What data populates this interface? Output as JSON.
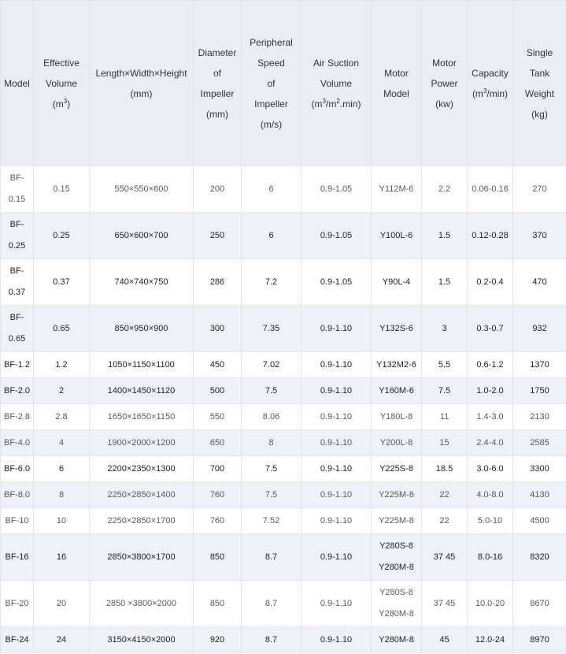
{
  "headers": [
    {
      "key": "model",
      "lines": [
        "Model"
      ]
    },
    {
      "key": "effective_volume",
      "lines": [
        "Effective",
        "Volume",
        "(m³)"
      ]
    },
    {
      "key": "dimensions",
      "lines": [
        "Length×Width×Height",
        "(mm)"
      ]
    },
    {
      "key": "impeller_diameter",
      "lines": [
        "Diameter",
        "of",
        "Impeller",
        "(mm)"
      ]
    },
    {
      "key": "peripheral_speed",
      "lines": [
        "Peripheral",
        "Speed",
        "of",
        "Impeller",
        "(m/s)"
      ]
    },
    {
      "key": "air_suction_volume",
      "lines": [
        "Air Suction",
        "Volume",
        "(m³/m².min)"
      ]
    },
    {
      "key": "motor_model",
      "lines": [
        "Motor",
        "Model"
      ]
    },
    {
      "key": "motor_power",
      "lines": [
        "Motor",
        "Power",
        "(kw)"
      ]
    },
    {
      "key": "capacity",
      "lines": [
        "Capacity",
        "(m³/min)"
      ]
    },
    {
      "key": "tank_weight",
      "lines": [
        "Single",
        "Tank",
        "Weight",
        "(kg)"
      ]
    }
  ],
  "rows": [
    {
      "model": "BF-0.15",
      "effective_volume": "0.15",
      "dimensions": "550×550×600",
      "impeller_diameter": "200",
      "peripheral_speed": "6",
      "air_suction_volume": "0.9-1.05",
      "motor_model": [
        "Y112M-6"
      ],
      "motor_power": "2.2",
      "capacity": "0.06-0.16",
      "tank_weight": "270"
    },
    {
      "model": "BF-0.25",
      "effective_volume": "0.25",
      "dimensions": "650×600×700",
      "impeller_diameter": "250",
      "peripheral_speed": "6",
      "air_suction_volume": "0.9-1.05",
      "motor_model": [
        "Y100L-6"
      ],
      "motor_power": "1.5",
      "capacity": "0.12-0.28",
      "tank_weight": "370"
    },
    {
      "model": "BF-0.37",
      "effective_volume": "0.37",
      "dimensions": "740×740×750",
      "impeller_diameter": "286",
      "peripheral_speed": "7.2",
      "air_suction_volume": "0.9-1.05",
      "motor_model": [
        "Y90L-4"
      ],
      "motor_power": "1.5",
      "capacity": "0.2-0.4",
      "tank_weight": "470"
    },
    {
      "model": "BF-0.65",
      "effective_volume": "0.65",
      "dimensions": "850×950×900",
      "impeller_diameter": "300",
      "peripheral_speed": "7.35",
      "air_suction_volume": "0.9-1.10",
      "motor_model": [
        "Y132S-6"
      ],
      "motor_power": "3",
      "capacity": "0.3-0.7",
      "tank_weight": "932"
    },
    {
      "model": "BF-1.2",
      "effective_volume": "1.2",
      "dimensions": "1050×1150×1100",
      "impeller_diameter": "450",
      "peripheral_speed": "7.02",
      "air_suction_volume": "0.9-1.10",
      "motor_model": [
        "Y132M2-6"
      ],
      "motor_power": "5.5",
      "capacity": "0.6-1.2",
      "tank_weight": "1370"
    },
    {
      "model": "BF-2.0",
      "effective_volume": "2",
      "dimensions": "1400×1450×1120",
      "impeller_diameter": "500",
      "peripheral_speed": "7.5",
      "air_suction_volume": "0.9-1.10",
      "motor_model": [
        "Y160M-6"
      ],
      "motor_power": "7.5",
      "capacity": "1.0-2.0",
      "tank_weight": "1750"
    },
    {
      "model": "BF-2.8",
      "effective_volume": "2.8",
      "dimensions": "1650×1650×1150",
      "impeller_diameter": "550",
      "peripheral_speed": "8.06",
      "air_suction_volume": "0.9-1.10",
      "motor_model": [
        "Y180L-8"
      ],
      "motor_power": "11",
      "capacity": "1.4-3.0",
      "tank_weight": "2130"
    },
    {
      "model": "BF-4.0",
      "effective_volume": "4",
      "dimensions": "1900×2000×1200",
      "impeller_diameter": "650",
      "peripheral_speed": "8",
      "air_suction_volume": "0.9-1.10",
      "motor_model": [
        "Y200L-8"
      ],
      "motor_power": "15",
      "capacity": "2.4-4.0",
      "tank_weight": "2585"
    },
    {
      "model": "BF-6.0",
      "effective_volume": "6",
      "dimensions": "2200×2350×1300",
      "impeller_diameter": "700",
      "peripheral_speed": "7.5",
      "air_suction_volume": "0.9-1.10",
      "motor_model": [
        "Y225S-8"
      ],
      "motor_power": "18.5",
      "capacity": "3.0-6.0",
      "tank_weight": "3300"
    },
    {
      "model": "BF-8.0",
      "effective_volume": "8",
      "dimensions": "2250×2850×1400",
      "impeller_diameter": "760",
      "peripheral_speed": "7.5",
      "air_suction_volume": "0.9-1.10",
      "motor_model": [
        "Y225M-8"
      ],
      "motor_power": "22",
      "capacity": "4.0-8.0",
      "tank_weight": "4130"
    },
    {
      "model": "BF-10",
      "effective_volume": "10",
      "dimensions": "2250×2850×1700",
      "impeller_diameter": "760",
      "peripheral_speed": "7.52",
      "air_suction_volume": "0.9-1.10",
      "motor_model": [
        "Y225M-8"
      ],
      "motor_power": "22",
      "capacity": "5.0-10",
      "tank_weight": "4500"
    },
    {
      "model": "BF-16",
      "effective_volume": "16",
      "dimensions": "2850×3800×1700",
      "impeller_diameter": "850",
      "peripheral_speed": "8.7",
      "air_suction_volume": "0.9-1.10",
      "motor_model": [
        "Y280S-8",
        "Y280M-8"
      ],
      "motor_power": "37 45",
      "capacity": "8.0-16",
      "tank_weight": "8320"
    },
    {
      "model": "BF-20",
      "effective_volume": "20",
      "dimensions": "2850 ×3800×2000",
      "impeller_diameter": "850",
      "peripheral_speed": "8.7",
      "air_suction_volume": "0.9-1.10",
      "motor_model": [
        "Y280S-8",
        "Y280M-8"
      ],
      "motor_power": "37 45",
      "capacity": "10.0-20",
      "tank_weight": "8670"
    },
    {
      "model": "BF-24",
      "effective_volume": "24",
      "dimensions": "3150×4150×2000",
      "impeller_diameter": "920",
      "peripheral_speed": "8.7",
      "air_suction_volume": "0.9-1.10",
      "motor_model": [
        "Y280M-8"
      ],
      "motor_power": "45",
      "capacity": "12.0-24",
      "tank_weight": "8970"
    }
  ]
}
